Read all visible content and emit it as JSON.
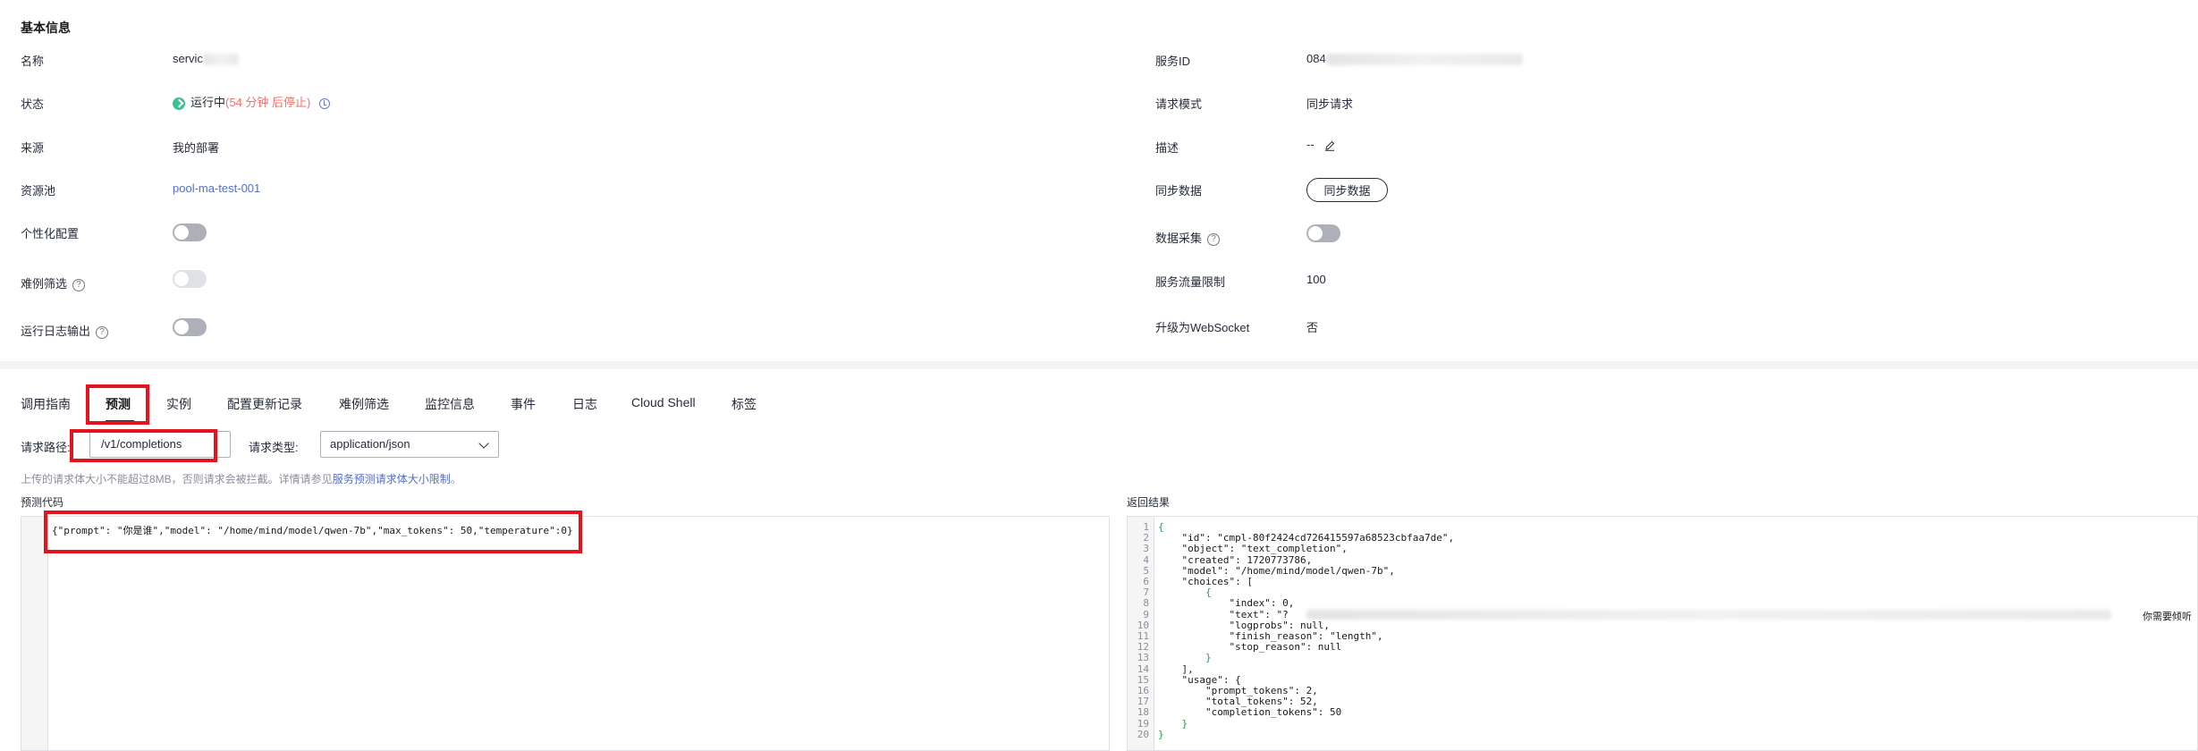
{
  "basic_info": {
    "title": "基本信息",
    "name_label": "名称",
    "name_value": "servic",
    "status_label": "状态",
    "status_value": "运行中",
    "status_note": "(54 分钟 后停止)",
    "source_label": "来源",
    "source_value": "我的部署",
    "pool_label": "资源池",
    "pool_value": "pool-ma-test-001",
    "personalized_label": "个性化配置",
    "hard_case_label": "难例筛选",
    "runtime_log_label": "运行日志输出",
    "service_id_label": "服务ID",
    "service_id_value": "084",
    "request_mode_label": "请求模式",
    "request_mode_value": "同步请求",
    "description_label": "描述",
    "description_value": "--",
    "sync_data_label": "同步数据",
    "sync_data_button": "同步数据",
    "data_collect_label": "数据采集",
    "rate_limit_label": "服务流量限制",
    "rate_limit_value": "100",
    "websocket_label": "升级为WebSocket",
    "websocket_value": "否",
    "help_glyph": "?",
    "toggles": {
      "personalized": false,
      "hard_case": false,
      "runtime_log": false,
      "data_collect": false
    }
  },
  "tabs": [
    {
      "label": "调用指南",
      "active": false
    },
    {
      "label": "预测",
      "active": true
    },
    {
      "label": "实例",
      "active": false
    },
    {
      "label": "配置更新记录",
      "active": false
    },
    {
      "label": "难例筛选",
      "active": false
    },
    {
      "label": "监控信息",
      "active": false
    },
    {
      "label": "事件",
      "active": false
    },
    {
      "label": "日志",
      "active": false
    },
    {
      "label": "Cloud Shell",
      "active": false
    },
    {
      "label": "标签",
      "active": false
    }
  ],
  "predict": {
    "path_label": "请求路径:",
    "path_value": "/v1/completions",
    "type_label": "请求类型:",
    "type_value": "application/json",
    "hint_prefix": "上传的请求体大小不能超过8MB，否则请求会被拦截。详情请参见",
    "hint_link": "服务预测请求体大小限制",
    "hint_suffix": "。",
    "code_label": "预测代码",
    "code_value": "{\"prompt\": \"你是谁\",\"model\": \"/home/mind/model/qwen-7b\",\"max_tokens\": 50,\"temperature\":0}",
    "result_label": "返回结果",
    "result_lines": [
      "{",
      "    \"id\": \"cmpl-80f2424cd726415597a68523cbfaa7de\",",
      "    \"object\": \"text_completion\",",
      "    \"created\": 1720773786,",
      "    \"model\": \"/home/mind/model/qwen-7b\",",
      "    \"choices\": [",
      "        {",
      "            \"index\": 0,",
      "            \"text\": \"?",
      "            \"logprobs\": null,",
      "            \"finish_reason\": \"length\",",
      "            \"stop_reason\": null",
      "        }",
      "    ],",
      "    \"usage\": {",
      "        \"prompt_tokens\": 2,",
      "        \"total_tokens\": 52,",
      "        \"completion_tokens\": 50",
      "    }",
      "}"
    ],
    "result_trailing_text": "你需要倾听"
  },
  "colors": {
    "accent_link": "#526ecc",
    "status_green": "#3ac295",
    "stop_red": "#f66f6a",
    "highlight_red": "#e3141e"
  }
}
